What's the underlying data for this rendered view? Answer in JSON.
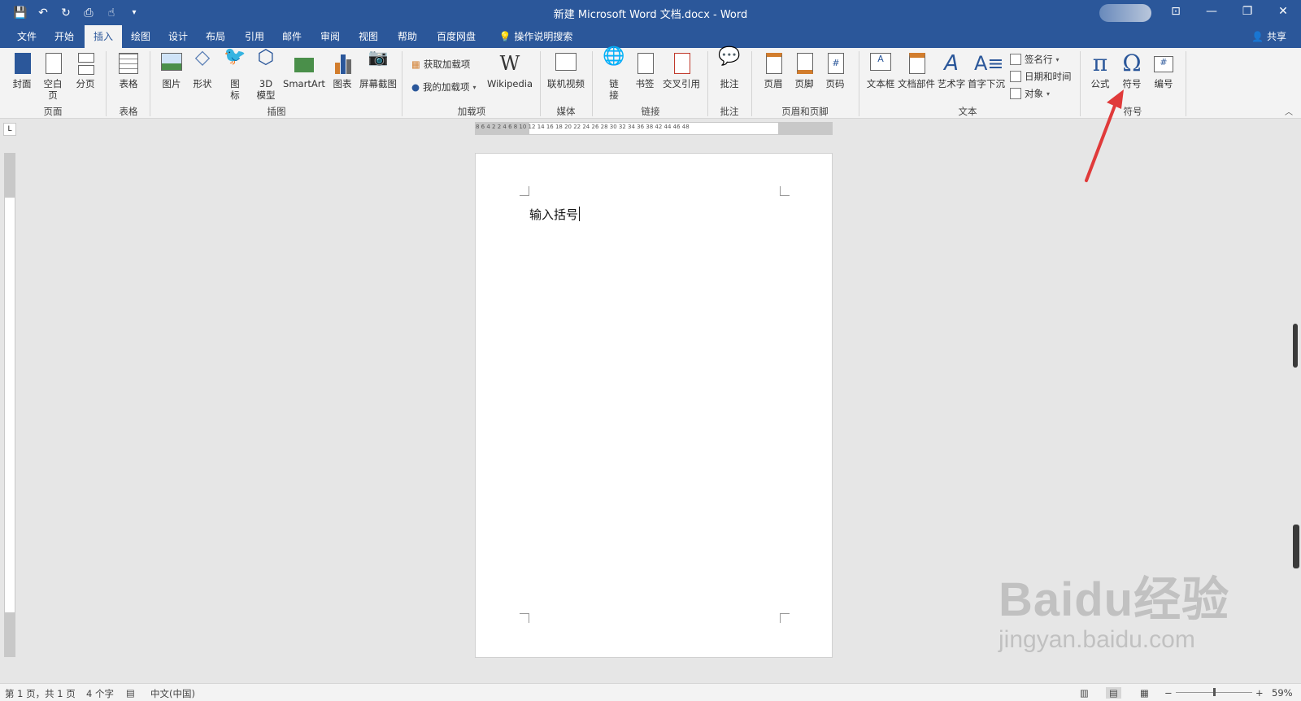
{
  "window": {
    "title": "新建 Microsoft Word 文档.docx  -  Word",
    "controls": {
      "ribbon_display": "⊡",
      "minimize": "—",
      "restore": "❐",
      "close": "✕"
    }
  },
  "qat": {
    "save": "💾",
    "undo": "↶",
    "redo": "↻",
    "preview": "⎙",
    "touch": "☝",
    "customize": "▾"
  },
  "tabs": [
    {
      "label": "文件"
    },
    {
      "label": "开始"
    },
    {
      "label": "插入"
    },
    {
      "label": "绘图"
    },
    {
      "label": "设计"
    },
    {
      "label": "布局"
    },
    {
      "label": "引用"
    },
    {
      "label": "邮件"
    },
    {
      "label": "审阅"
    },
    {
      "label": "视图"
    },
    {
      "label": "帮助"
    },
    {
      "label": "百度网盘"
    },
    {
      "label": "操作说明搜索"
    }
  ],
  "active_tab": "插入",
  "share_label": "共享",
  "ribbon": {
    "pages": {
      "cover": "封面",
      "blank": "空白页",
      "break": "分页",
      "group": "页面"
    },
    "tables": {
      "table": "表格",
      "group": "表格"
    },
    "illustrations": {
      "picture": "图片",
      "shapes": "形状",
      "icons": "图\n标",
      "model3d": "3D\n模型",
      "smartart": "SmartArt",
      "chart": "图表",
      "screenshot": "屏幕截图",
      "group": "插图"
    },
    "addins": {
      "get": "获取加载项",
      "my": "我的加载项",
      "wikipedia": "Wikipedia",
      "group": "加载项"
    },
    "media": {
      "video": "联机视频",
      "group": "媒体"
    },
    "links": {
      "link": "链\n接",
      "bookmark": "书签",
      "crossref": "交叉引用",
      "group": "链接"
    },
    "comments": {
      "comment": "批注",
      "group": "批注"
    },
    "headerfooter": {
      "header": "页眉",
      "footer": "页脚",
      "pagenum": "页码",
      "group": "页眉和页脚"
    },
    "text": {
      "textbox": "文本框",
      "quickparts": "文档部件",
      "wordart": "艺术字",
      "dropcap": "首字下沉",
      "signature": "签名行",
      "datetime": "日期和时间",
      "object": "对象",
      "group": "文本"
    },
    "symbols": {
      "equation": "公式",
      "symbol": "符号",
      "number": "编号",
      "group": "符号"
    }
  },
  "ruler": {
    "numbers": "8   6   4   2        2   4   6   8  10  12  14  16  18  20  22  24  26  28  30  32  34  36  38       42  44  46  48"
  },
  "document": {
    "text": "输入括号"
  },
  "status": {
    "page": "第 1 页，共 1 页",
    "words": "4 个字",
    "lang": "中文(中国)",
    "zoom": "59%"
  },
  "watermark": {
    "logo": "Baidu经验",
    "url": "jingyan.baidu.com"
  }
}
